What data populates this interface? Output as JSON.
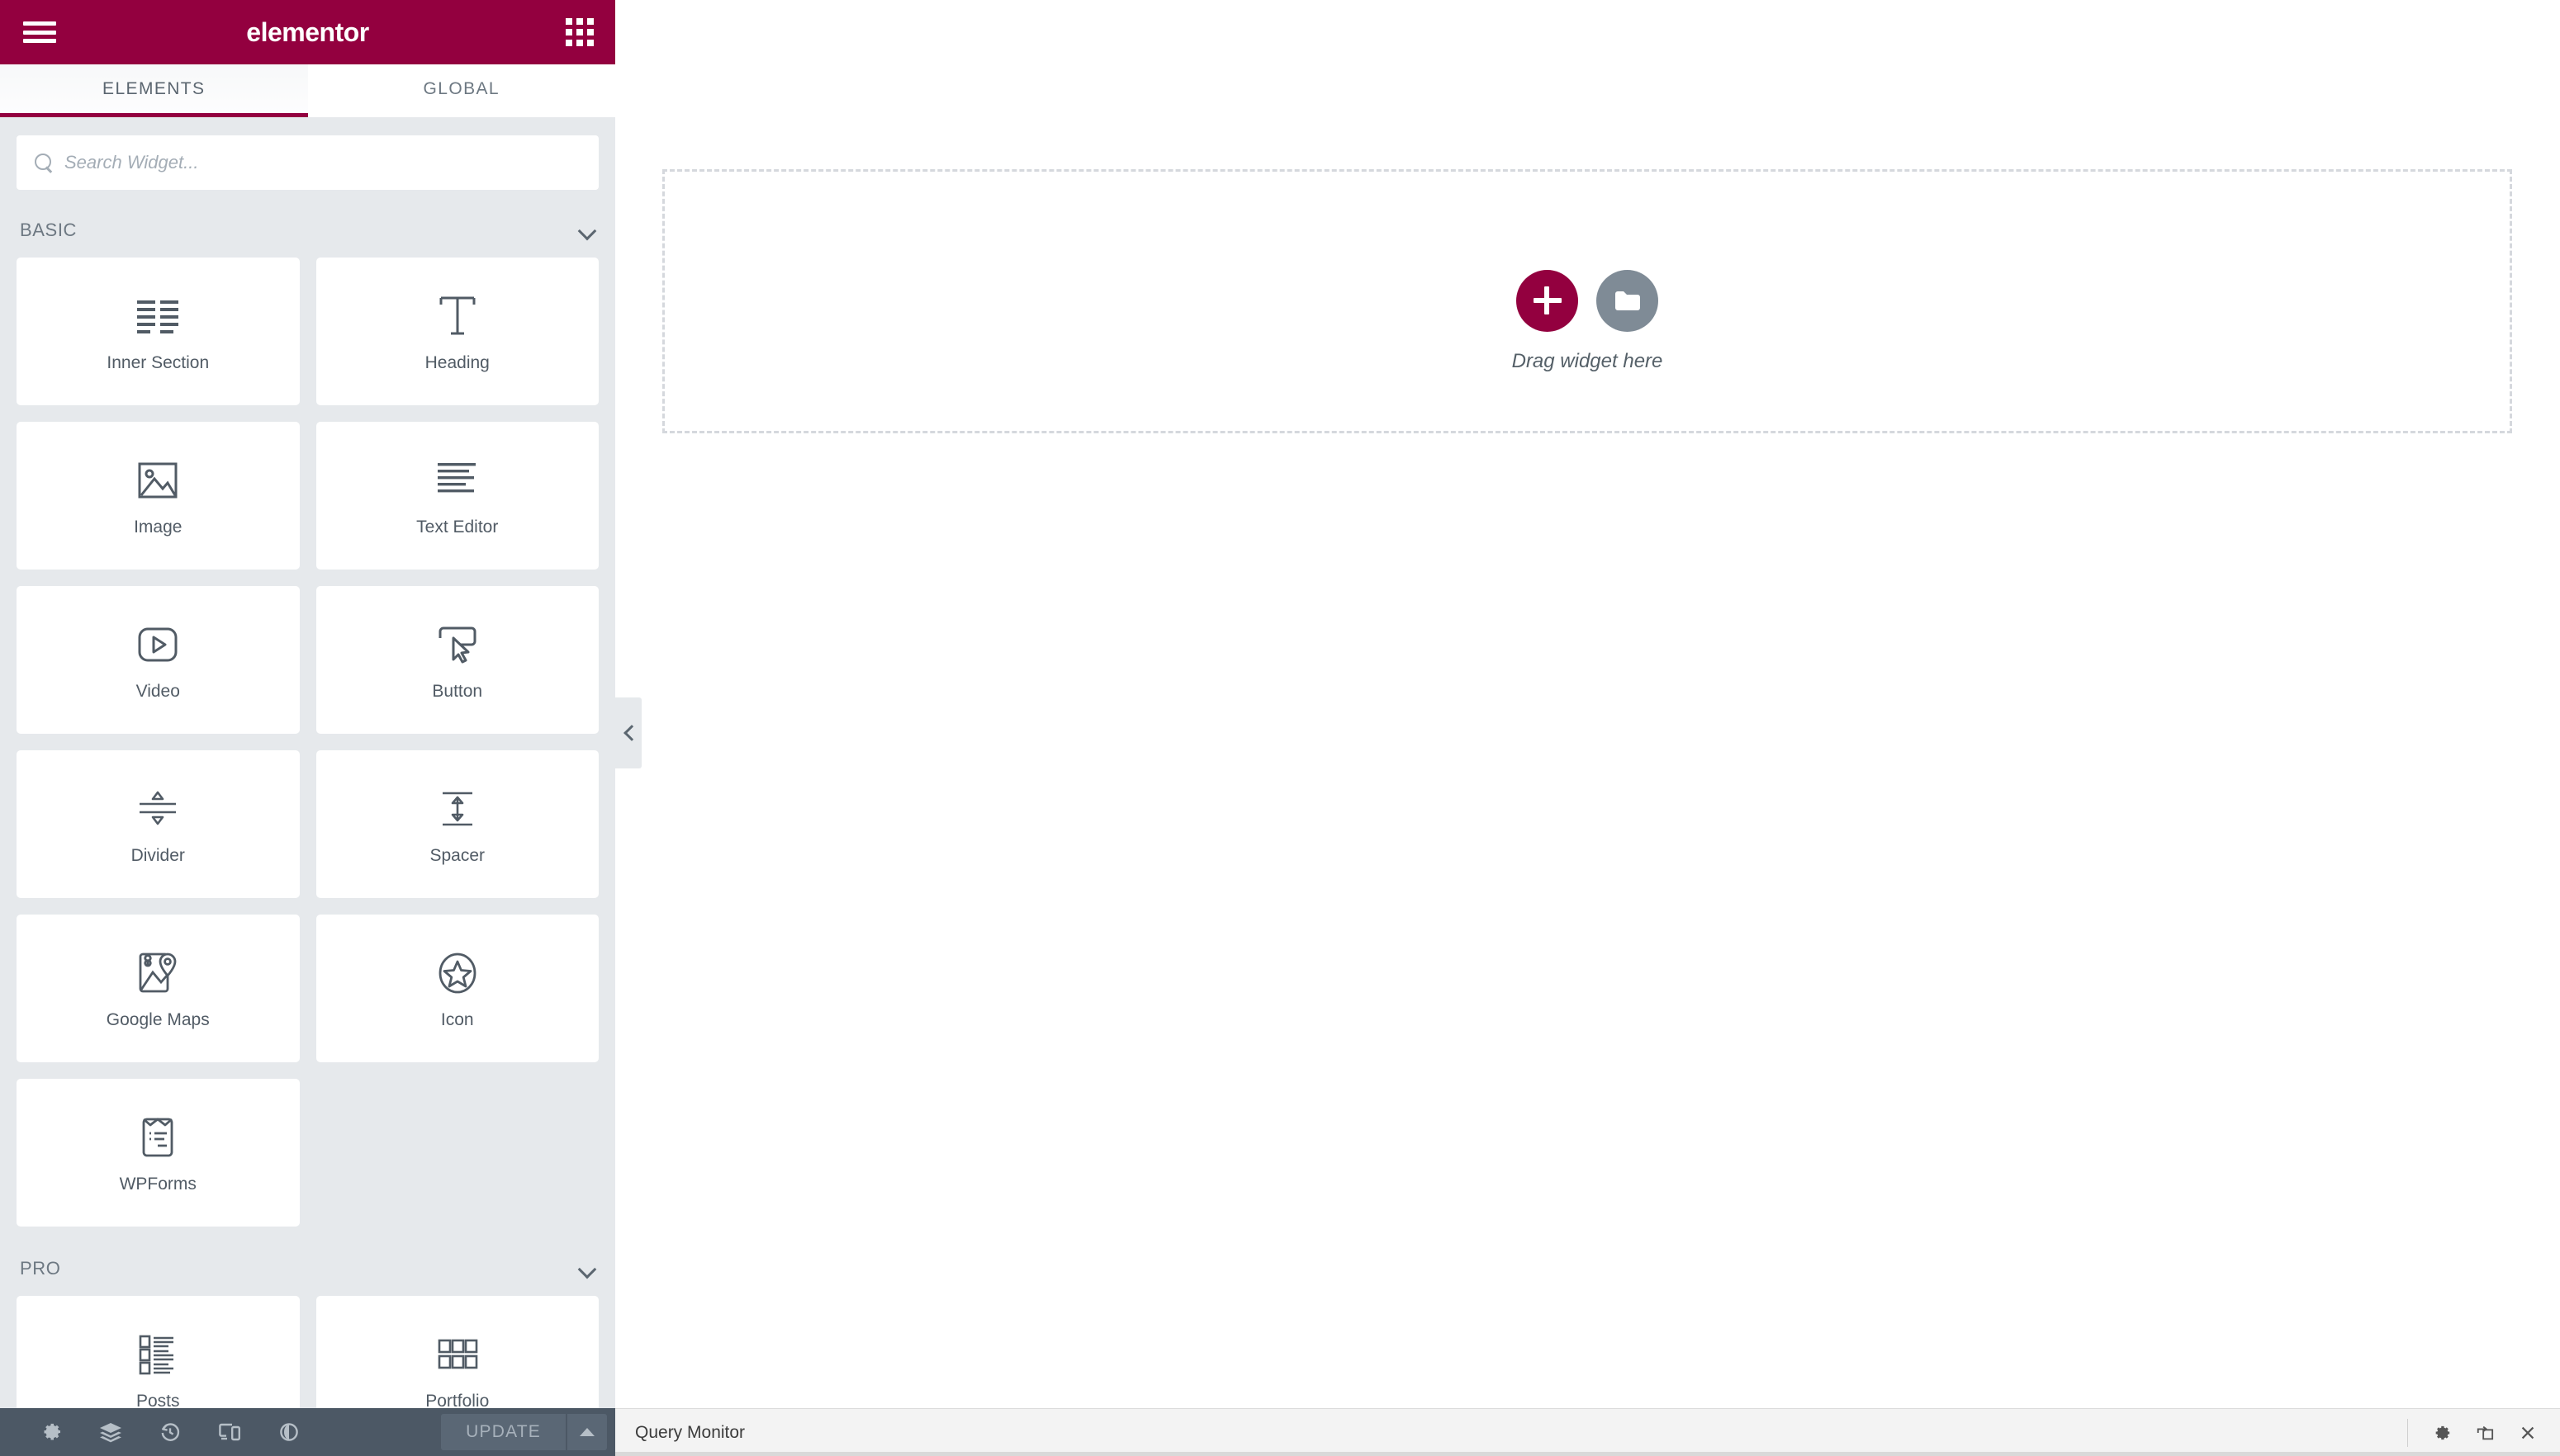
{
  "header": {
    "logo": "elementor",
    "menu_icon": "hamburger-icon",
    "widgets_icon": "grid-icon"
  },
  "tabs": [
    {
      "label": "ELEMENTS",
      "active": true
    },
    {
      "label": "GLOBAL",
      "active": false
    }
  ],
  "search": {
    "placeholder": "Search Widget...",
    "value": "",
    "icon": "search-icon"
  },
  "sections": [
    {
      "title": "BASIC",
      "collapse_icon": "chevron-down-icon",
      "widgets": [
        {
          "label": "Inner Section",
          "icon": "inner-section-icon"
        },
        {
          "label": "Heading",
          "icon": "heading-icon"
        },
        {
          "label": "Image",
          "icon": "image-icon"
        },
        {
          "label": "Text Editor",
          "icon": "text-editor-icon"
        },
        {
          "label": "Video",
          "icon": "video-icon"
        },
        {
          "label": "Button",
          "icon": "button-icon"
        },
        {
          "label": "Divider",
          "icon": "divider-icon"
        },
        {
          "label": "Spacer",
          "icon": "spacer-icon"
        },
        {
          "label": "Google Maps",
          "icon": "google-maps-icon"
        },
        {
          "label": "Icon",
          "icon": "star-icon"
        },
        {
          "label": "WPForms",
          "icon": "wpforms-icon"
        }
      ]
    },
    {
      "title": "PRO",
      "collapse_icon": "chevron-down-icon",
      "widgets": [
        {
          "label": "Posts",
          "icon": "posts-icon"
        },
        {
          "label": "Portfolio",
          "icon": "portfolio-icon"
        }
      ]
    }
  ],
  "canvas": {
    "drop_zone_label": "Drag widget here",
    "add_section_icon": "plus-icon",
    "add_template_icon": "folder-icon",
    "collapse_panel_icon": "chevron-left-icon"
  },
  "editor_bar": {
    "icons": [
      {
        "name": "settings-gear-icon",
        "title": "Settings"
      },
      {
        "name": "navigator-layers-icon",
        "title": "Navigator"
      },
      {
        "name": "history-revisions-icon",
        "title": "History"
      },
      {
        "name": "responsive-mode-icon",
        "title": "Responsive Mode"
      },
      {
        "name": "preview-eye-icon",
        "title": "Preview Changes"
      }
    ],
    "update_label": "UPDATE",
    "update_caret_icon": "caret-up-icon"
  },
  "query_monitor": {
    "title": "Query Monitor",
    "settings_icon": "gear-icon",
    "popout_icon": "popout-window-icon",
    "close_icon": "close-icon"
  },
  "colors": {
    "brand_crimson": "#93003f",
    "panel_bg": "#e6e9ec",
    "card_bg": "#ffffff",
    "bar_dark": "#4c5865",
    "icon_gray": "#515b65",
    "template_gray": "#7f8b96"
  }
}
